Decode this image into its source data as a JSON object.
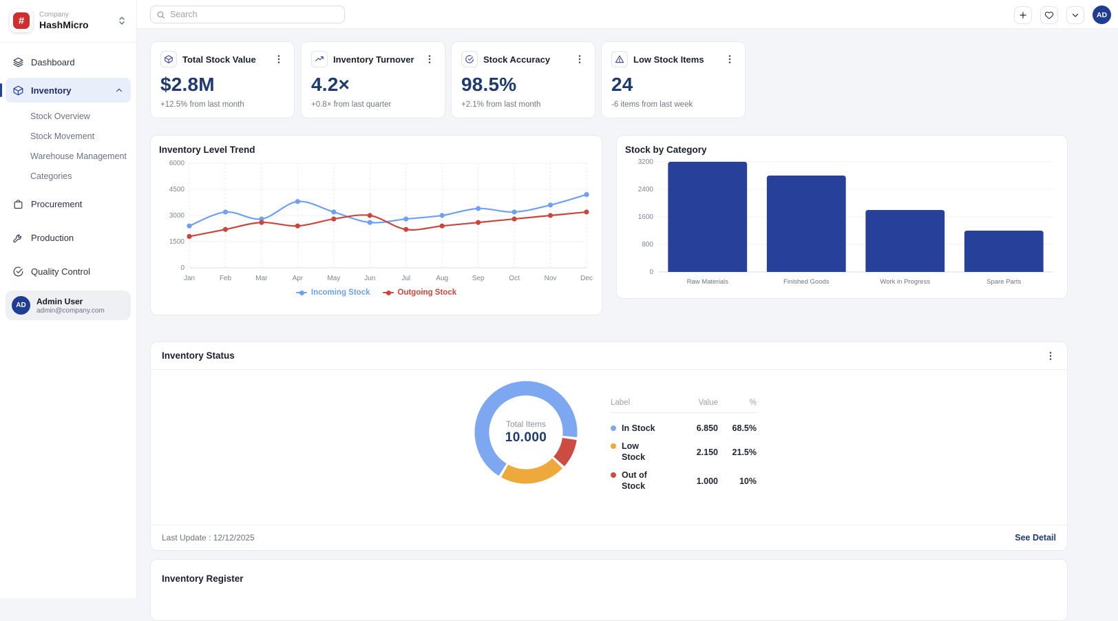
{
  "sidebar": {
    "company_label": "Company",
    "company_name": "HashMicro",
    "logo_glyph": "#",
    "items": [
      {
        "label": "Dashboard"
      },
      {
        "label": "Inventory"
      },
      {
        "label": "Procurement"
      },
      {
        "label": "Production"
      },
      {
        "label": "Quality Control"
      }
    ],
    "inventory_children": [
      {
        "label": "Stock Overview"
      },
      {
        "label": "Stock Movement"
      },
      {
        "label": "Warehouse Management"
      },
      {
        "label": "Categories"
      }
    ],
    "user": {
      "initials": "AD",
      "name": "Admin User",
      "email": "admin@company.com"
    }
  },
  "topbar": {
    "search_placeholder": "Search",
    "avatar_initials": "AD"
  },
  "kpis": [
    {
      "title": "Total Stock Value",
      "value": "$2.8M",
      "delta": "+12.5% from last month",
      "icon": "cube-icon"
    },
    {
      "title": "Inventory Turnover",
      "value": "4.2×",
      "delta": "+0.8× from last quarter",
      "icon": "trend-up-icon"
    },
    {
      "title": "Stock Accuracy",
      "value": "98.5%",
      "delta": "+2.1% from last month",
      "icon": "check-circle-icon"
    },
    {
      "title": "Low Stock Items",
      "value": "24",
      "delta": "-6 items from last week",
      "icon": "warning-triangle-icon"
    }
  ],
  "chart_data": [
    {
      "type": "line",
      "title": "Inventory Level Trend",
      "x": [
        "Jan",
        "Feb",
        "Mar",
        "Apr",
        "May",
        "Jun",
        "Jul",
        "Aug",
        "Sep",
        "Oct",
        "Nov",
        "Dec"
      ],
      "series": [
        {
          "name": "Incoming Stock",
          "color": "#6f9ff0",
          "values": [
            2400,
            3200,
            2800,
            3800,
            3200,
            2600,
            2800,
            3000,
            3400,
            3200,
            3600,
            4200
          ]
        },
        {
          "name": "Outgoing Stock",
          "color": "#c9463d",
          "values": [
            1800,
            2200,
            2600,
            2400,
            2800,
            3000,
            2200,
            2400,
            2600,
            2800,
            3000,
            3200
          ]
        }
      ],
      "ylim": [
        0,
        6000
      ],
      "yticks": [
        0,
        1500,
        3000,
        4500,
        6000
      ],
      "grid": true,
      "legend_position": "bottom"
    },
    {
      "type": "bar",
      "title": "Stock by Category",
      "categories": [
        "Raw Materials",
        "Finished Goods",
        "Work in Progress",
        "Spare Parts"
      ],
      "values": [
        3200,
        2800,
        1800,
        1200
      ],
      "color": "#27409a",
      "ylim": [
        0,
        3200
      ],
      "yticks": [
        0,
        800,
        1600,
        2400,
        3200
      ],
      "grid": true
    },
    {
      "type": "pie",
      "title": "Inventory Status",
      "center_label": "Total Items",
      "center_value": "10.000",
      "start_angle": 97,
      "segments": [
        {
          "label": "In Stock",
          "value": 6850,
          "pct": 68.5,
          "color": "#7da7f0"
        },
        {
          "label": "Low Stock",
          "value": 2150,
          "pct": 21.5,
          "color": "#eda93c"
        },
        {
          "label": "Out of Stock",
          "value": 1000,
          "pct": 10,
          "color": "#cc4b43"
        }
      ]
    }
  ],
  "status": {
    "title": "Inventory Status",
    "table": {
      "headers": [
        "Label",
        "Value",
        "%"
      ],
      "rows": [
        {
          "label": "In Stock",
          "value": "6.850",
          "pct": "68.5%",
          "color": "#7da7f0"
        },
        {
          "label": "Low Stock",
          "value": "2.150",
          "pct": "21.5%",
          "color": "#eda93c"
        },
        {
          "label": "Out of Stock",
          "value": "1.000",
          "pct": "10%",
          "color": "#cc4b43"
        }
      ]
    },
    "last_update": "Last Update : 12/12/2025",
    "see_detail": "See Detail"
  },
  "register": {
    "title": "Inventory Register"
  }
}
